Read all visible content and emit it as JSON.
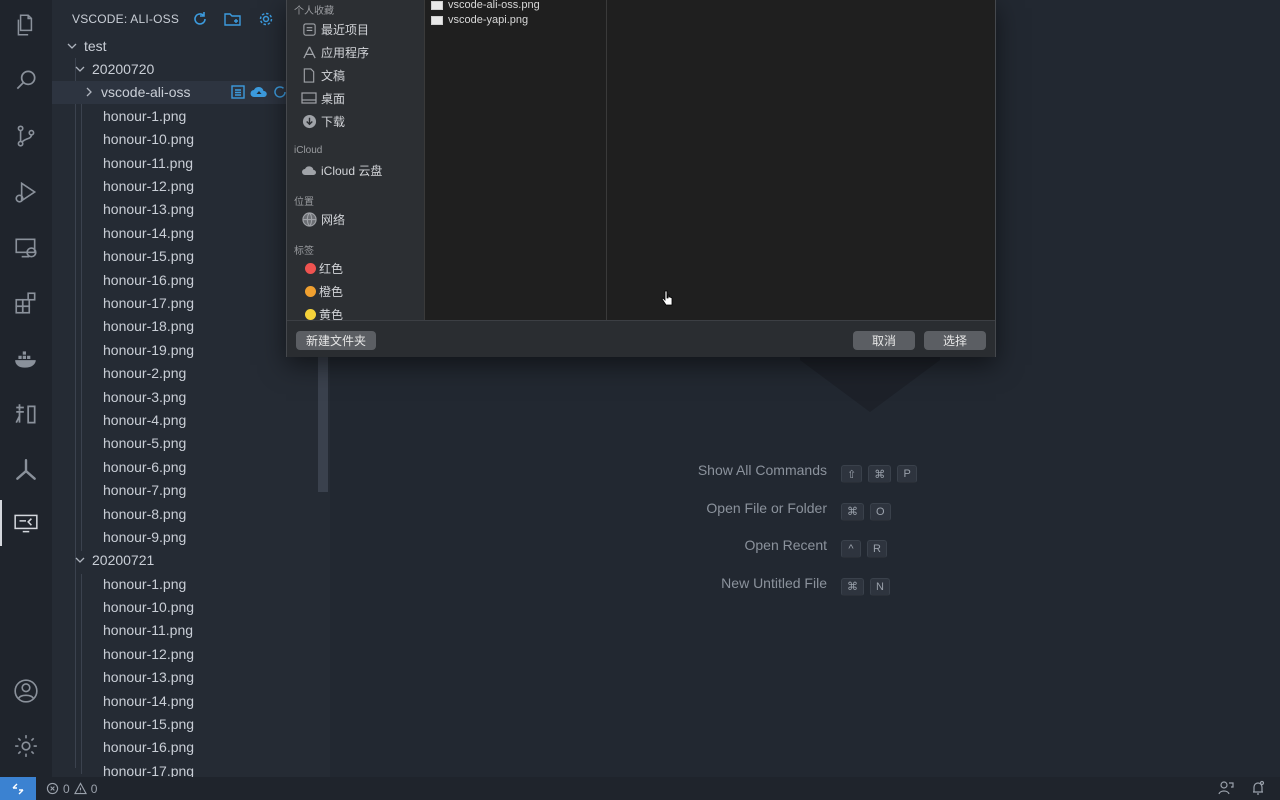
{
  "activity_bar": {
    "items": [
      "explorer-icon",
      "search-icon",
      "source-control-icon",
      "run-debug-icon",
      "remote-explorer-icon",
      "extensions-icon",
      "docker-icon",
      "zhihu-icon",
      "yapi-icon",
      "ali-oss-icon"
    ],
    "bottom": [
      "account-icon",
      "settings-gear-icon"
    ]
  },
  "sidebar": {
    "title": "VSCODE: ALI-OSS",
    "root": "test",
    "folder1": {
      "name": "20200720",
      "subfolder": "vscode-ali-oss",
      "files": [
        "honour-1.png",
        "honour-10.png",
        "honour-11.png",
        "honour-12.png",
        "honour-13.png",
        "honour-14.png",
        "honour-15.png",
        "honour-16.png",
        "honour-17.png",
        "honour-18.png",
        "honour-19.png",
        "honour-2.png",
        "honour-3.png",
        "honour-4.png",
        "honour-5.png",
        "honour-6.png",
        "honour-7.png",
        "honour-8.png",
        "honour-9.png"
      ]
    },
    "folder2": {
      "name": "20200721",
      "files": [
        "honour-1.png",
        "honour-10.png",
        "honour-11.png",
        "honour-12.png",
        "honour-13.png",
        "honour-14.png",
        "honour-15.png",
        "honour-16.png",
        "honour-17.png"
      ]
    }
  },
  "dialog": {
    "favorites_label": "个人收藏",
    "favorites": [
      {
        "icon": "recents-icon",
        "label": "最近项目"
      },
      {
        "icon": "applications-icon",
        "label": "应用程序"
      },
      {
        "icon": "documents-icon",
        "label": "文稿"
      },
      {
        "icon": "desktop-icon",
        "label": "桌面"
      },
      {
        "icon": "downloads-icon",
        "label": "下载"
      }
    ],
    "icloud_label": "iCloud",
    "icloud_drive": "iCloud 云盘",
    "locations_label": "位置",
    "network": "网络",
    "tags_label": "标签",
    "tags": [
      {
        "label": "红色",
        "color": "#ef5350"
      },
      {
        "label": "橙色",
        "color": "#f0a030"
      },
      {
        "label": "黄色",
        "color": "#f5d23a"
      }
    ],
    "files": [
      "vscode-ali-oss.png",
      "vscode-yapi.png"
    ],
    "new_folder": "新建文件夹",
    "cancel": "取消",
    "choose": "选择"
  },
  "welcome": {
    "shortcuts": [
      {
        "label": "Show All Commands",
        "keys": [
          "⇧",
          "⌘",
          "P"
        ]
      },
      {
        "label": "Open File or Folder",
        "keys": [
          "⌘",
          "O"
        ]
      },
      {
        "label": "Open Recent",
        "keys": [
          "^",
          "R"
        ]
      },
      {
        "label": "New Untitled File",
        "keys": [
          "⌘",
          "N"
        ]
      }
    ]
  },
  "status_bar": {
    "errors": "0",
    "warnings": "0",
    "accent": "#3b82d1"
  }
}
